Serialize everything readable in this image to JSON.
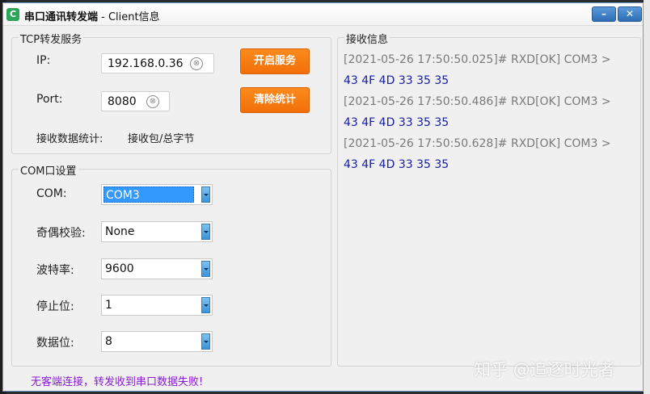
{
  "window": {
    "app_name": "串口通讯转发端",
    "subtitle": " - Client信息",
    "min_label": "–",
    "close_label": "✕"
  },
  "tcp": {
    "group_title": "TCP转发服务",
    "ip_label": "IP:",
    "ip_value": "192.168.0.36",
    "port_label": "Port:",
    "port_value": "8080",
    "stats_label": "接收数据统计:",
    "stats_value": "接收包/总字节",
    "start_button": "开启服务",
    "clear_stats_button": "清除统计",
    "clear_icon": "⊗"
  },
  "com": {
    "group_title": "COM口设置",
    "fields": [
      {
        "label": "COM:",
        "value": "COM3"
      },
      {
        "label": "奇偶校验:",
        "value": "None"
      },
      {
        "label": "波特率:",
        "value": "9600"
      },
      {
        "label": "停止位:",
        "value": "1"
      },
      {
        "label": "数据位:",
        "value": "8"
      }
    ]
  },
  "receive": {
    "group_title": "接收信息",
    "entries": [
      {
        "meta": "[2021-05-26 17:50:50.025]# RXD[OK] COM3 >",
        "hex": "43 4F 4D 33 35 35"
      },
      {
        "meta": "[2021-05-26 17:50:50.486]# RXD[OK] COM3 >",
        "hex": "43 4F 4D 33 35 35"
      },
      {
        "meta": "[2021-05-26 17:50:50.628]# RXD[OK] COM3 >",
        "hex": "43 4F 4D 33 35 35"
      }
    ]
  },
  "status_message": "无客端连接，转发收到串口数据失败!",
  "watermark": "知乎 @追逐时光者",
  "colors": {
    "accent_button": "#f57a12",
    "status_text": "#8b1cd6",
    "log_hex": "#1a20a0",
    "log_meta": "#7a7a7a",
    "selection": "#3399ff"
  }
}
